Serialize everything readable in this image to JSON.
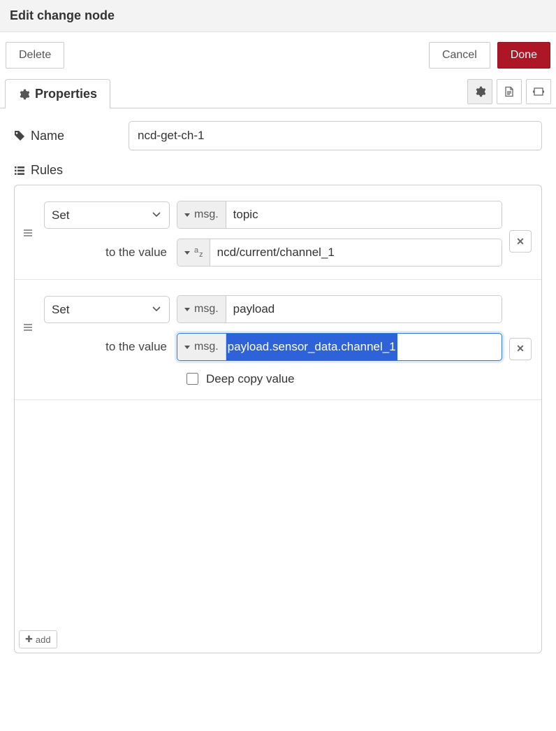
{
  "header": {
    "title": "Edit change node"
  },
  "buttons": {
    "delete": "Delete",
    "cancel": "Cancel",
    "done": "Done"
  },
  "tabs": {
    "properties": "Properties"
  },
  "form": {
    "name_label": "Name",
    "name_value": "ncd-get-ch-1",
    "rules_label": "Rules",
    "add_label": "add"
  },
  "typed": {
    "msg": "msg."
  },
  "rules": [
    {
      "action": "Set",
      "target_prefix": "msg.",
      "target_value": "topic",
      "to_label": "to the value",
      "value_type": "string",
      "value_prefix": "",
      "value": "ncd/current/channel_1",
      "focused": false,
      "highlighted": false,
      "deep_copy": false,
      "show_deep_copy": false
    },
    {
      "action": "Set",
      "target_prefix": "msg.",
      "target_value": "payload",
      "to_label": "to the value",
      "value_type": "msg",
      "value_prefix": "msg.",
      "value": "payload.sensor_data.channel_1",
      "focused": true,
      "highlighted": true,
      "deep_copy": false,
      "deep_copy_label": "Deep copy value",
      "show_deep_copy": true
    }
  ]
}
